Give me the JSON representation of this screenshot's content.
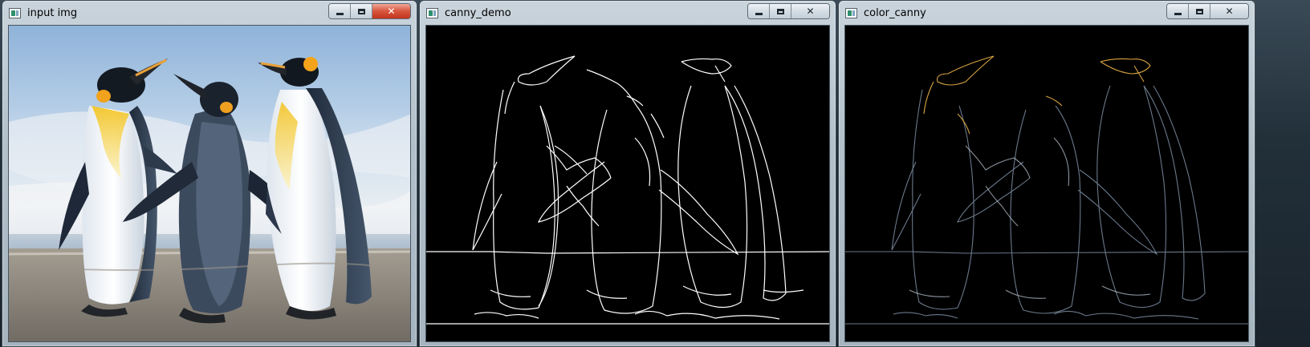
{
  "windows": [
    {
      "id": "input",
      "title": "input img",
      "buttons": {
        "minimize": "minimize-icon",
        "maximize": "maximize-icon",
        "close": "close-icon"
      },
      "close_style": "red",
      "content": "penguins-photo"
    },
    {
      "id": "canny",
      "title": "canny_demo",
      "buttons": {
        "minimize": "minimize-icon",
        "maximize": "maximize-icon",
        "close": "close-icon"
      },
      "close_style": "plain",
      "content": "white-edge-map"
    },
    {
      "id": "color",
      "title": "color_canny",
      "buttons": {
        "minimize": "minimize-icon",
        "maximize": "maximize-icon",
        "close": "close-icon"
      },
      "close_style": "plain",
      "content": "color-edge-map"
    }
  ],
  "colors": {
    "close_red": "#c2351e",
    "edge_white": "#ffffff",
    "edge_gold": "#d9a441",
    "sky_top": "#8fb3d9",
    "sand": "#8f8a80"
  },
  "glyphs": {
    "close": "✕"
  }
}
